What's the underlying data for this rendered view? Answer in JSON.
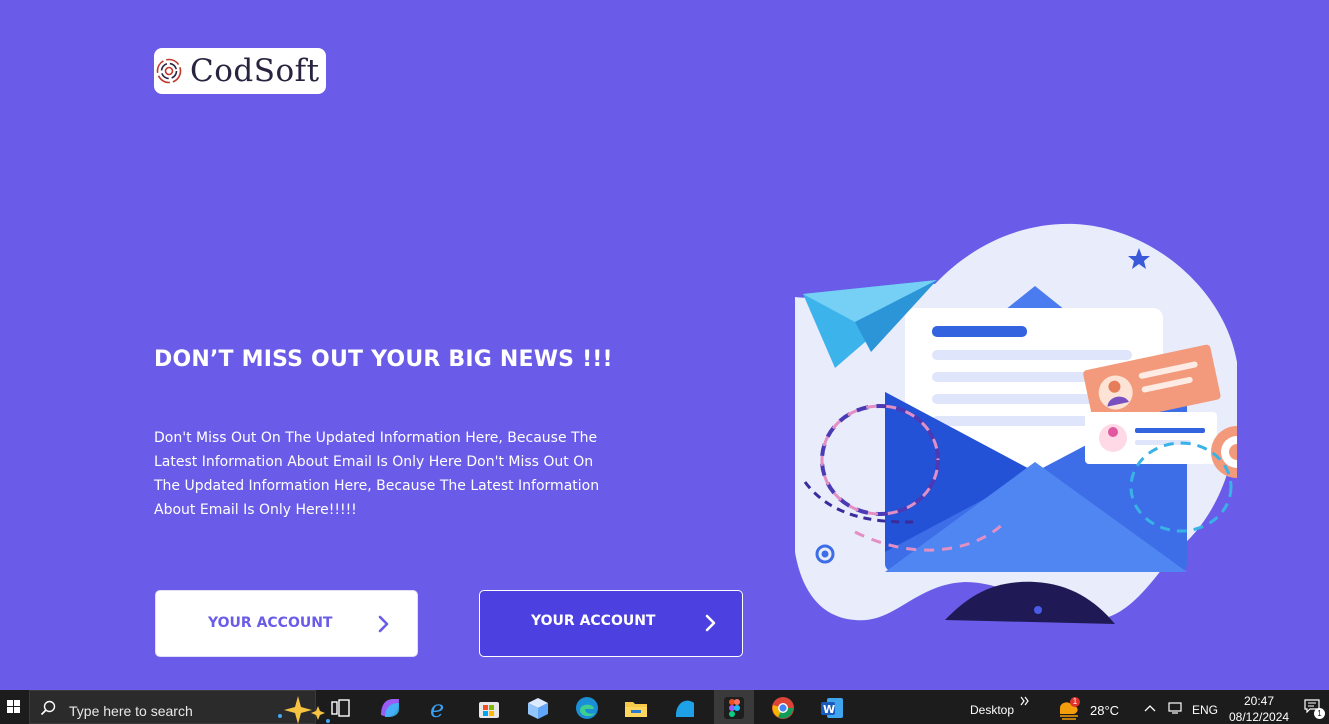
{
  "brand": {
    "logo_text": "CodSoft"
  },
  "hero": {
    "headline": "DON’T MISS OUT YOUR BIG NEWS !!!",
    "body": "Don't Miss Out On The Updated Information Here, Because The Latest Information About Email Is Only Here Don't Miss Out On The Updated Information Here, Because The Latest Information About Email Is Only Here!!!!!",
    "primary_button": "YOUR ACCOUNT",
    "secondary_button": "YOUR ACCOUNT"
  },
  "colors": {
    "background": "#6a5ce8",
    "button_dark": "#4c40e0",
    "white": "#ffffff"
  },
  "taskbar": {
    "search_placeholder": "Type here to search",
    "desktop_label": "Desktop",
    "weather_temp": "28°C",
    "weather_badge": "1",
    "language": "ENG",
    "time": "20:47",
    "date": "08/12/2024",
    "notification_count": "1",
    "icons": [
      "start-icon",
      "search-icon",
      "copilot-sparkle-icon",
      "task-view-icon",
      "copilot-icon",
      "internet-explorer-icon",
      "microsoft-store-icon",
      "3d-box-icon",
      "edge-icon",
      "file-explorer-icon",
      "app-icon",
      "figma-icon",
      "chrome-icon",
      "word-icon"
    ]
  }
}
